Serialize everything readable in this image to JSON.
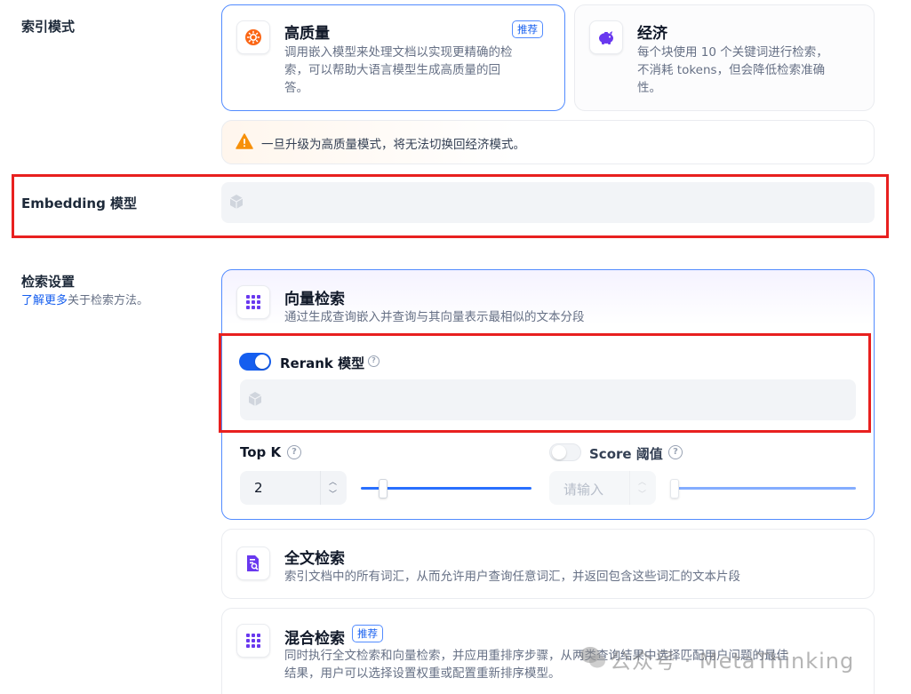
{
  "index_mode": {
    "label": "索引模式",
    "high_quality": {
      "title": "高质量",
      "badge": "推荐",
      "desc_line1": "调用嵌入模型来处理文档以实现更精确的检",
      "desc_line2": "索，可以帮助大语言模型生成高质量的回",
      "desc_line3": "答。"
    },
    "economy": {
      "title": "经济",
      "desc_line1": "每个块使用 10 个关键词进行检索，",
      "desc_line2": "不消耗 tokens，但会降低检索准确",
      "desc_line3": "性。"
    },
    "warning": "一旦升级为高质量模式，将无法切换回经济模式。"
  },
  "embedding": {
    "label": "Embedding 模型"
  },
  "retrieval": {
    "label": "检索设置",
    "learn_more": "了解更多",
    "learn_more_suffix": "关于检索方法。",
    "vector": {
      "title": "向量检索",
      "desc": "通过生成查询嵌入并查询与其向量表示最相似的文本分段"
    },
    "rerank": {
      "label": "Rerank 模型",
      "enabled": true
    },
    "top_k": {
      "label": "Top K",
      "value": "2",
      "slider_fraction": 0.1
    },
    "score": {
      "label": "Score 阈值",
      "enabled": false,
      "placeholder": "请输入"
    },
    "fulltext": {
      "title": "全文检索",
      "desc": "索引文档中的所有词汇，从而允许用户查询任意词汇，并返回包含这些词汇的文本片段"
    },
    "hybrid": {
      "title": "混合检索",
      "badge": "推荐",
      "desc_line1": "同时执行全文检索和向量检索，并应用重排序步骤，从两类查询结果中选择匹配用户问题的最佳",
      "desc_line2": "结果，用户可以选择设置权重或配置重新排序模型。"
    }
  },
  "watermark": "公众号 · MetaThinking",
  "colors": {
    "accent": "#155eef",
    "highlight_border": "#e8201f",
    "warning": "#f79009"
  }
}
